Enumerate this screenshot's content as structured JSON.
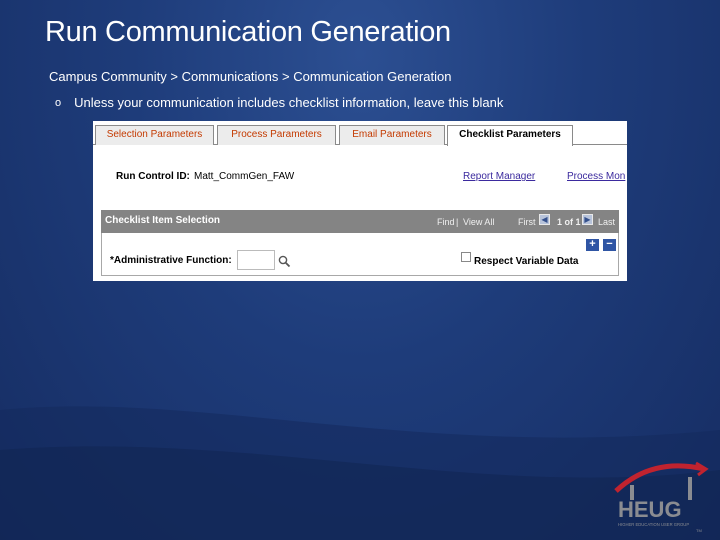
{
  "slide": {
    "title": "Run Communication Generation",
    "breadcrumb": "Campus Community > Communications > Communication Generation",
    "bullet_marker": "o",
    "bullet_text": "Unless your communication includes checklist information, leave this blank"
  },
  "screen": {
    "tabs": [
      {
        "label": "Selection Parameters",
        "active": false
      },
      {
        "label": "Process Parameters",
        "active": false
      },
      {
        "label": "Email Parameters",
        "active": false
      },
      {
        "label": "Checklist Parameters",
        "active": true
      }
    ],
    "run_control_label": "Run Control ID:",
    "run_control_value": "Matt_CommGen_FAW",
    "report_manager_link": "Report Manager",
    "process_monitor_link": "Process Mon",
    "grid": {
      "title": "Checklist Item Selection",
      "find": "Find",
      "separator": "|",
      "view_all": "View All",
      "first": "First",
      "page_info": "1 of 1",
      "last": "Last"
    },
    "admin_function_label": "*Administrative Function:",
    "admin_function_value": "",
    "respect_variable_label": "Respect Variable Data",
    "respect_variable_checked": false
  },
  "logo": {
    "text": "HEUG",
    "subtext": "HIGHER EDUCATION USER GROUP",
    "tm": "TM"
  },
  "colors": {
    "background": "#1e3c7a",
    "tab_link": "#c43a00",
    "link": "#3b2a9e",
    "grid_header": "#848484",
    "logo_red": "#c0232f",
    "logo_gray": "#8a8c91"
  }
}
